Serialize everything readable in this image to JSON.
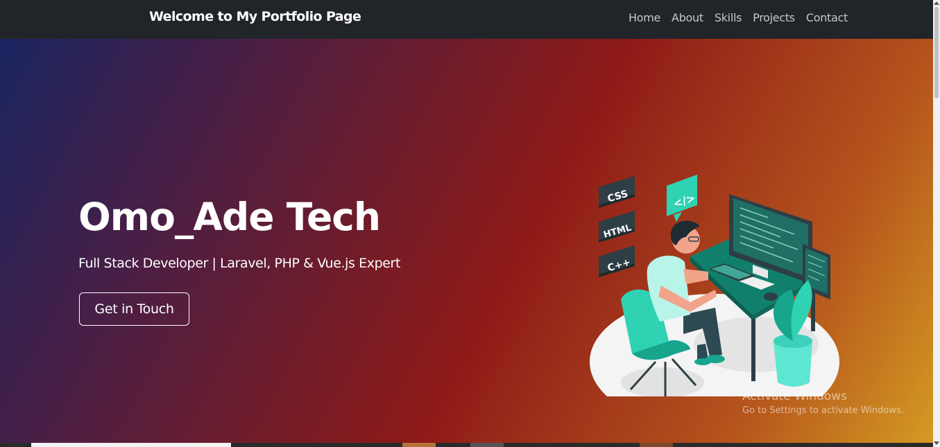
{
  "navbar": {
    "brand": "Welcome to My Portfolio Page",
    "links": [
      "Home",
      "About",
      "Skills",
      "Projects",
      "Contact"
    ]
  },
  "hero": {
    "title": "Omo_Ade Tech",
    "subtitle": "Full Stack Developer | Laravel, PHP & Vue.js Expert",
    "cta_label": "Get in Touch",
    "illustration": {
      "badges": [
        "CSS",
        "HTML",
        "C++"
      ],
      "code_bubble": "</>"
    }
  },
  "watermark": {
    "title": "Activate Windows",
    "subtitle": "Go to Settings to activate Windows."
  },
  "colors": {
    "navbar_bg": "#212529",
    "accent_teal": "#2fd3b4",
    "gradient_start": "#1a2560",
    "gradient_mid": "#8e1a18",
    "gradient_end": "#d49a22"
  }
}
